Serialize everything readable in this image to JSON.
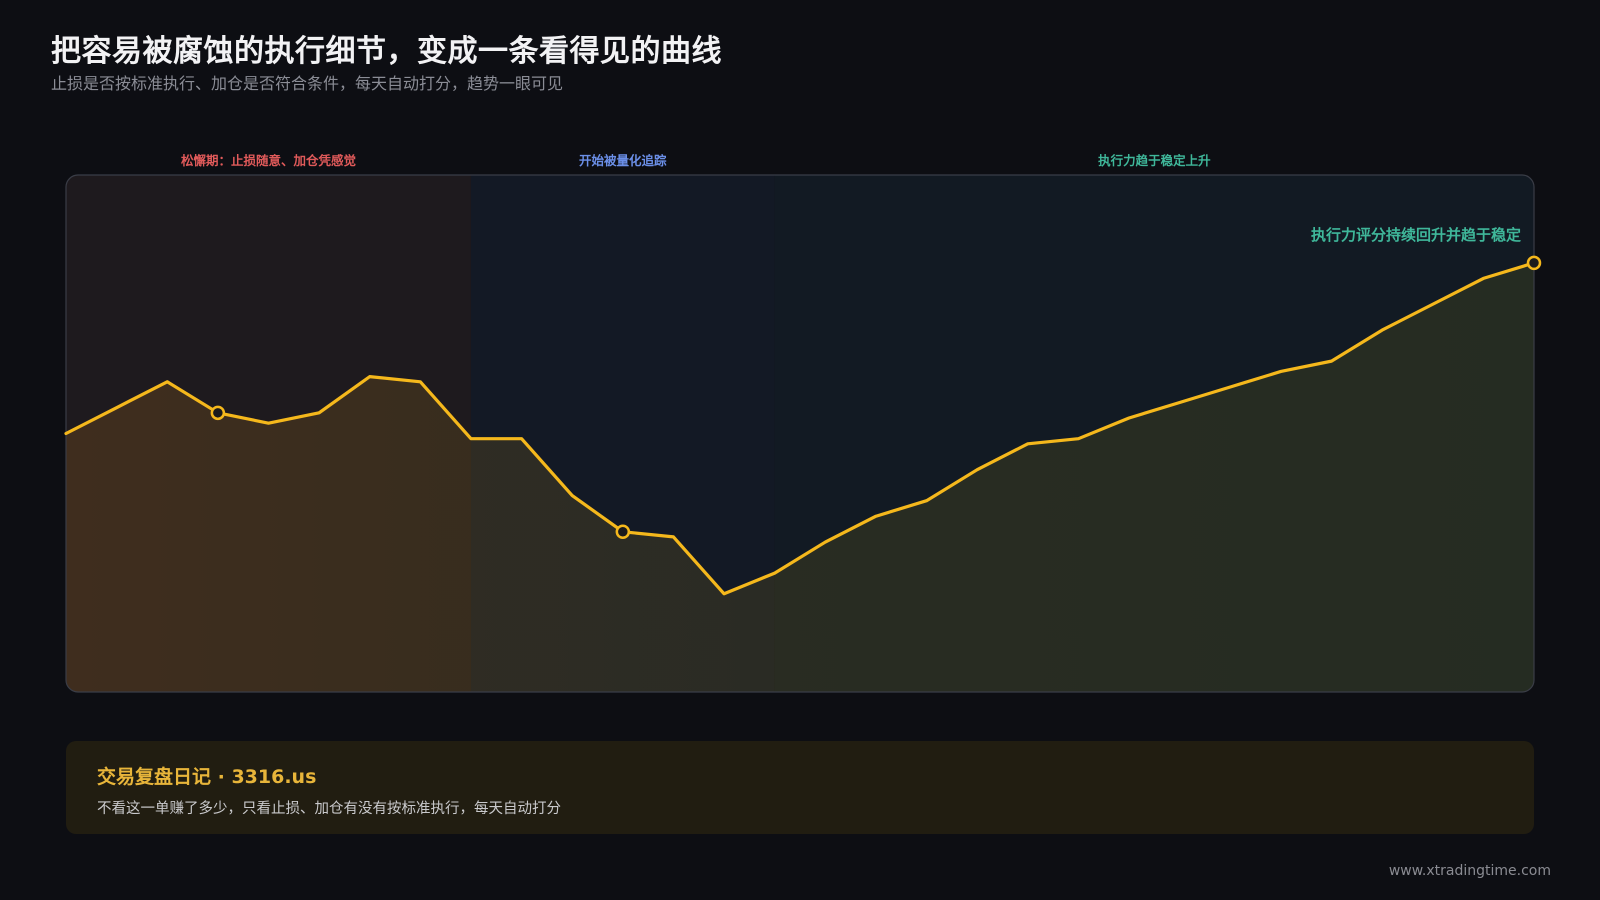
{
  "header": {
    "title": "把容易被腐蚀的执行细节，变成一条看得见的曲线",
    "subtitle": "止损是否按标准执行、加仓是否符合条件，每天自动打分，趋势一眼可见"
  },
  "phases": [
    {
      "label": "松懈期：止损随意、加仓凭感觉",
      "color": "#e05a5a"
    },
    {
      "label": "开始被量化追踪",
      "color": "#6b8fe8"
    },
    {
      "label": "执行力趋于稳定上升",
      "color": "#3fb79a"
    }
  ],
  "chart_data": {
    "type": "area",
    "title": "",
    "xlabel": "",
    "ylabel": "",
    "x": [
      1,
      2,
      3,
      4,
      5,
      6,
      7,
      8,
      9,
      10,
      11,
      12,
      13,
      14,
      15,
      16,
      17,
      18,
      19,
      20,
      21,
      22,
      23,
      24,
      25,
      26,
      27,
      28,
      29,
      30
    ],
    "series": [
      {
        "color": "#f5b81c",
        "values": [
          50,
          55,
          60,
          54,
          52,
          54,
          61,
          60,
          49,
          49,
          38,
          31,
          30,
          19,
          23,
          29,
          34,
          37,
          43,
          48,
          49,
          53,
          56,
          59,
          62,
          64,
          70,
          75,
          80,
          83
        ]
      }
    ],
    "ylim": [
      0,
      100
    ],
    "highlighted_points": [
      4,
      12,
      30
    ],
    "phase_ranges": [
      [
        1,
        9
      ],
      [
        9,
        15
      ],
      [
        15,
        30
      ]
    ],
    "annotations": [
      {
        "x": 30,
        "text": "执行力评分持续回升并趋于稳定",
        "color": "#3fb79a"
      }
    ],
    "grid": false,
    "legend": "none",
    "colors": {
      "line": "#f5b81c",
      "phase_bg": [
        "#1e1a1e",
        "#131925",
        "#121a23"
      ]
    }
  },
  "footer": {
    "title": "交易复盘日记 · 3316.us",
    "description": "不看这一单赚了多少，只看止损、加仓有没有按标准执行，每天自动打分"
  },
  "site_url": "www.xtradingtime.com"
}
